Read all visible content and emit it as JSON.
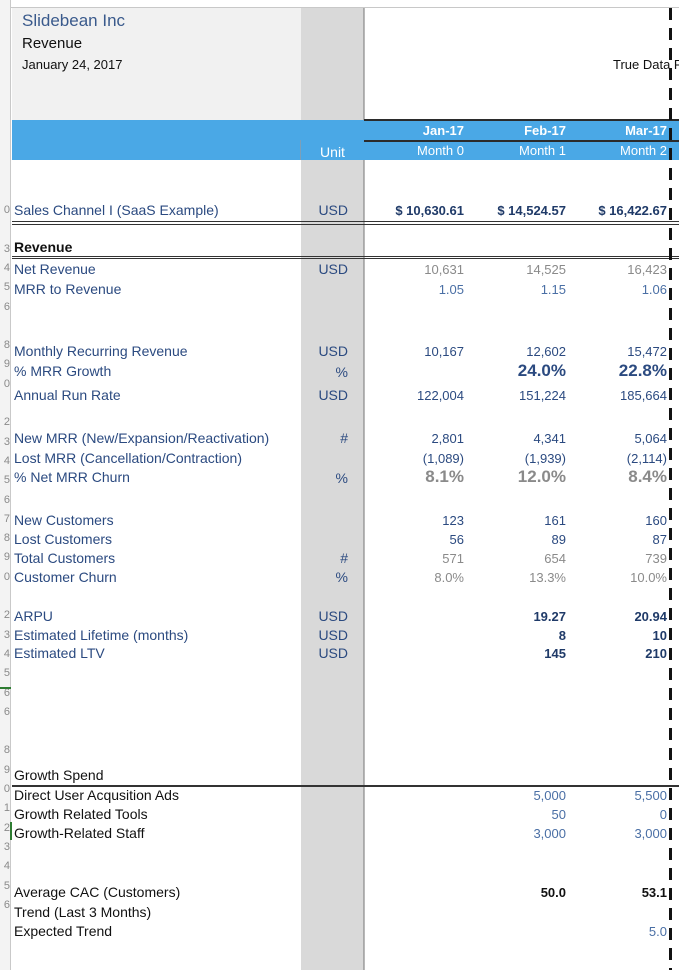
{
  "header": {
    "company": "Slidebean Inc",
    "report": "Revenue",
    "date": "January 24, 2017",
    "true_data_label": "True Data P"
  },
  "columns": {
    "unit_header": "Unit",
    "months": [
      {
        "date": "Jan-17",
        "index": "Month 0"
      },
      {
        "date": "Feb-17",
        "index": "Month 1"
      },
      {
        "date": "Mar-17",
        "index": "Month 2"
      }
    ]
  },
  "row_numbers": [
    "0",
    "",
    "3",
    "4",
    "5",
    "6",
    "",
    "8",
    "9",
    "0",
    "",
    "2",
    "3",
    "4",
    "5",
    "6",
    "7",
    "8",
    "9",
    "0",
    "",
    "2",
    "3",
    "4",
    "5",
    "6",
    "6",
    "",
    "8",
    "9",
    "0",
    "1",
    "2",
    "3",
    "4",
    "5",
    "6",
    ""
  ],
  "rows": {
    "sales_channel": {
      "label": "Sales Channel I (SaaS Example)",
      "unit": "USD",
      "values": [
        "$  10,630.61",
        "$  14,524.57",
        "$  16,422.67"
      ]
    },
    "revenue_header": {
      "label": "Revenue"
    },
    "net_revenue": {
      "label": "Net Revenue",
      "unit": "USD",
      "values": [
        "10,631",
        "14,525",
        "16,423"
      ]
    },
    "mrr_to_revenue": {
      "label": "MRR to Revenue",
      "unit": "",
      "values": [
        "1.05",
        "1.15",
        "1.06"
      ]
    },
    "mrr": {
      "label": "Monthly Recurring Revenue",
      "unit": "USD",
      "values": [
        "10,167",
        "12,602",
        "15,472"
      ]
    },
    "mrr_growth": {
      "label": "% MRR Growth",
      "unit": "%",
      "values": [
        "",
        "24.0%",
        "22.8%"
      ]
    },
    "arr": {
      "label": "Annual Run Rate",
      "unit": "USD",
      "values": [
        "122,004",
        "151,224",
        "185,664"
      ]
    },
    "new_mrr": {
      "label": "New MRR (New/Expansion/Reactivation)",
      "unit": "#",
      "values": [
        "2,801",
        "4,341",
        "5,064"
      ]
    },
    "lost_mrr": {
      "label": "Lost MRR (Cancellation/Contraction)",
      "unit": "",
      "values": [
        "(1,089)",
        "(1,939)",
        "(2,114)"
      ]
    },
    "net_mrr_churn": {
      "label": "% Net MRR Churn",
      "unit": "%",
      "values": [
        "8.1%",
        "12.0%",
        "8.4%"
      ]
    },
    "new_customers": {
      "label": "New Customers",
      "unit": "",
      "values": [
        "123",
        "161",
        "160"
      ]
    },
    "lost_customers": {
      "label": "Lost Customers",
      "unit": "",
      "values": [
        "56",
        "89",
        "87"
      ]
    },
    "total_customers": {
      "label": "Total Customers",
      "unit": "#",
      "values": [
        "571",
        "654",
        "739"
      ]
    },
    "customer_churn": {
      "label": "Customer Churn",
      "unit": "%",
      "values": [
        "8.0%",
        "13.3%",
        "10.0%"
      ]
    },
    "arpu": {
      "label": "ARPU",
      "unit": "USD",
      "values": [
        "",
        "19.27",
        "20.94"
      ]
    },
    "lifetime": {
      "label": "Estimated Lifetime (months)",
      "unit": "USD",
      "values": [
        "",
        "8",
        "10"
      ]
    },
    "ltv": {
      "label": "Estimated LTV",
      "unit": "USD",
      "values": [
        "",
        "145",
        "210"
      ]
    },
    "growth_spend": {
      "label": "Growth Spend"
    },
    "ads": {
      "label": "Direct User Acqusition Ads",
      "values": [
        "",
        "5,000",
        "5,500"
      ]
    },
    "tools": {
      "label": "Growth Related Tools",
      "values": [
        "",
        "50",
        "0"
      ]
    },
    "staff": {
      "label": "Growth-Related Staff",
      "values": [
        "",
        "3,000",
        "3,000"
      ]
    },
    "cac": {
      "label": "Average CAC (Customers)",
      "values": [
        "",
        "50.0",
        "53.1"
      ]
    },
    "trend": {
      "label": "Trend (Last 3 Months)",
      "values": [
        "",
        "",
        ""
      ]
    },
    "expected_trend": {
      "label": "Expected Trend",
      "values": [
        "",
        "",
        "5.0"
      ]
    }
  },
  "colors": {
    "header_band": "#4aa8e6",
    "unit_column": "#d9d9d9",
    "label_text": "#2b4a80",
    "company_title": "#3a5a8c"
  }
}
